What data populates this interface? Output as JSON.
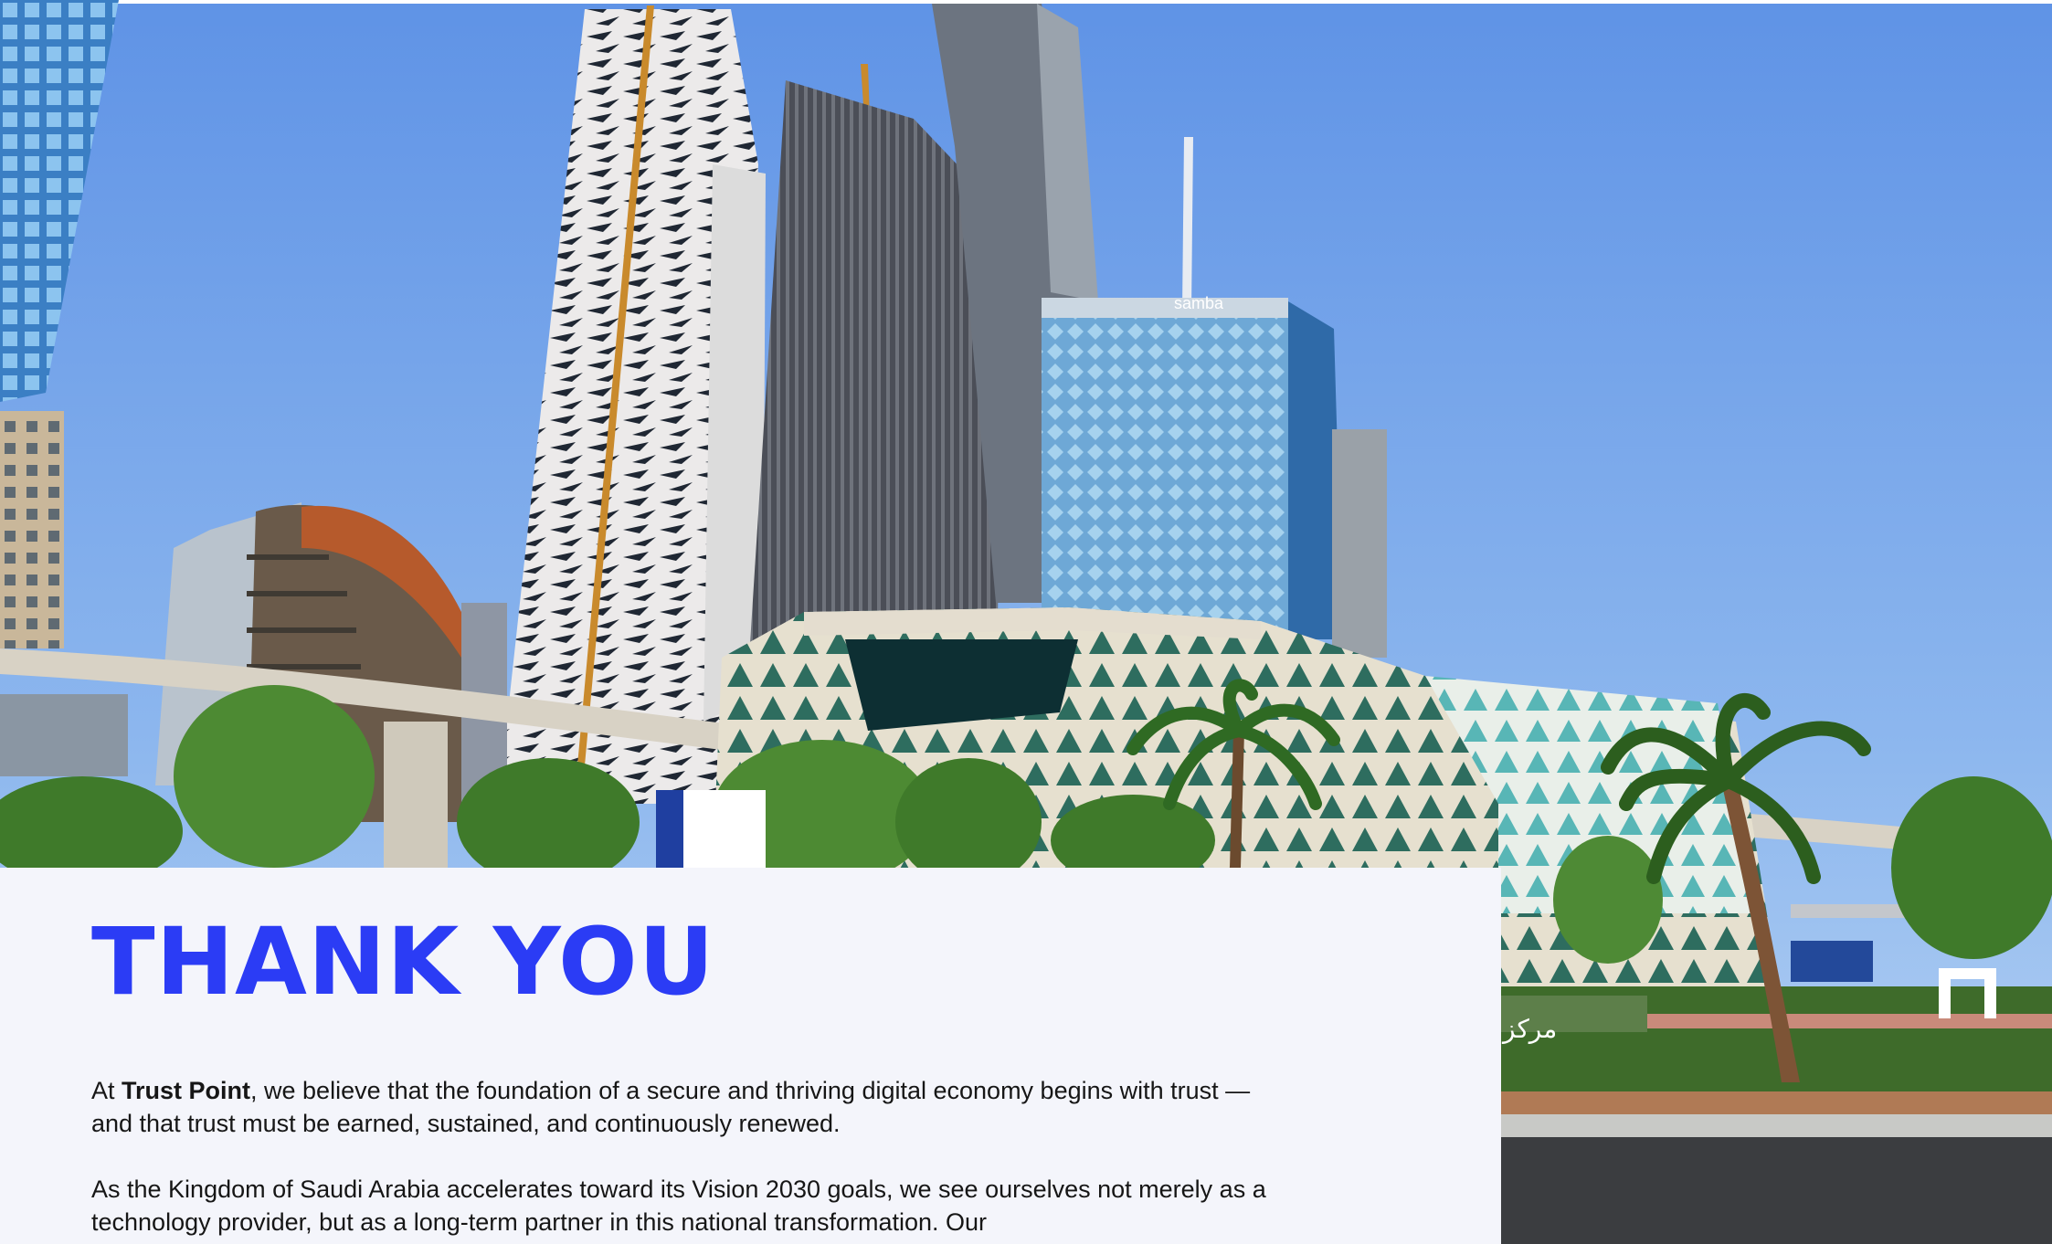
{
  "hero_image": {
    "building_sign": "samba",
    "arabic_sign": "مركز"
  },
  "title": "THANK YOU",
  "intro": {
    "prefix": "At ",
    "company": "Trust Point",
    "suffix": ", we believe that the foundation of a secure and thriving digital economy begins with trust — and that trust must be earned, sustained, and continuously renewed."
  },
  "paragraph2": "As the Kingdom of Saudi Arabia accelerates toward its Vision 2030 goals, we see ourselves not merely as a technology provider, but as a long-term partner in this national transformation. Our",
  "colors": {
    "accent": "#2b3cf5",
    "card_background": "#f4f5fb",
    "text": "#161616",
    "sky": "#87b3ea"
  }
}
